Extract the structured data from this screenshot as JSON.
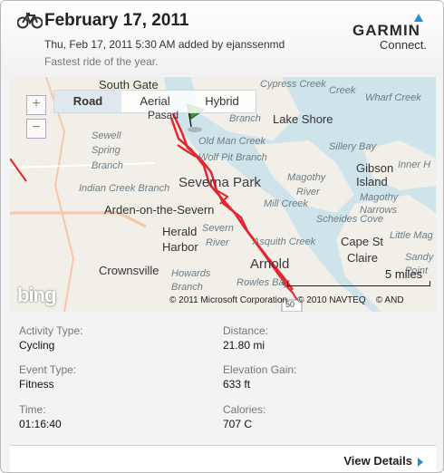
{
  "header": {
    "title": "February 17, 2011",
    "meta": "Thu, Feb 17, 2011 5:30 AM added by ejanssenmd",
    "note": "Fastest ride of the year.",
    "brand": "GARMIN",
    "brand_sub": "Connect."
  },
  "map": {
    "types": [
      "Road",
      "Aerial",
      "Hybrid"
    ],
    "active_type": "Road",
    "zoom_in": "+",
    "zoom_out": "−",
    "labels": {
      "south_gate": "South Gate",
      "pasadena": "Pasad",
      "cypress_creek": "Cypress Creek",
      "creek": "Creek",
      "wharf_creek": "Wharf Creek",
      "branch_top": "Branch",
      "lake_shore": "Lake Shore",
      "sewell": "Sewell",
      "spring": "Spring",
      "branch_left": "Branch",
      "old_man_creek": "Old Man Creek",
      "sillery_bay": "Sillery Bay",
      "wolf_pit_branch": "Wolf Pit Branch",
      "gibson": "Gibson",
      "island": "Island",
      "inner_h": "Inner H",
      "indian_creek_branch": "Indian Creek Branch",
      "severna_park": "Severna Park",
      "magothy_river": "Magothy",
      "river": "River",
      "magothy": "Magothy",
      "narrows": "Narrows",
      "arden": "Arden-on-the-Severn",
      "mill_creek": "Mill Creek",
      "scheides_cove": "Scheides Cove",
      "herald": "Herald",
      "harbor": "Harbor",
      "severn_river": "Severn",
      "river2": "River",
      "asquith_creek": "Asquith Creek",
      "cape_st_claire": "Cape St",
      "claire": "Claire",
      "little_magothy": "Little Mag",
      "sandy": "Sandy",
      "point": "Point",
      "crownsville": "Crownsville",
      "howards": "Howards",
      "branch_bottom": "Branch",
      "arnold": "Arnold",
      "rowles_bay": "Rowles Bay",
      "hwy": "50"
    },
    "scale_label": "5 miles",
    "bing": "bing",
    "copyright_ms": "© 2011 Microsoft Corporation",
    "copyright_navteq": "© 2010 NAVTEQ",
    "copyright_and": "© AND"
  },
  "stats": {
    "activity_type_label": "Activity Type:",
    "activity_type": "Cycling",
    "event_type_label": "Event Type:",
    "event_type": "Fitness",
    "time_label": "Time:",
    "time": "01:16:40",
    "distance_label": "Distance:",
    "distance": "21.80 mi",
    "elevation_label": "Elevation Gain:",
    "elevation": "633 ft",
    "calories_label": "Calories:",
    "calories": "707 C"
  },
  "footer": {
    "view_details": "View Details"
  },
  "colors": {
    "route": "#e3262f",
    "water": "#cfe3ea",
    "land": "#f2efe9",
    "accent": "#1e90d6"
  }
}
